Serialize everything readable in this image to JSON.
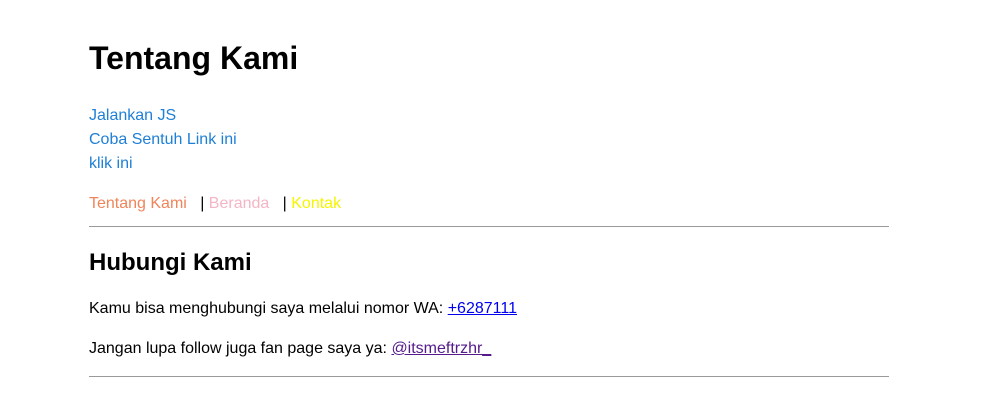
{
  "header": {
    "title": "Tentang Kami"
  },
  "js_links": [
    {
      "label": "Jalankan JS"
    },
    {
      "label": "Coba Sentuh Link ini"
    },
    {
      "label": "klik ini"
    }
  ],
  "nav": {
    "items": [
      {
        "label": "Tentang Kami",
        "color": "#f0845a"
      },
      {
        "label": "Beranda",
        "color": "#f4b6c4"
      },
      {
        "label": "Kontak",
        "color": "#f5f500"
      }
    ],
    "separator": "|"
  },
  "contact": {
    "heading": "Hubungi Kami",
    "wa_text": "Kamu bisa menghubungi saya melalui nomor WA: ",
    "wa_link": "+6287111",
    "fb_text": "Jangan lupa follow juga fan page saya ya: ",
    "fb_link": "@itsmeftrzhr_"
  }
}
